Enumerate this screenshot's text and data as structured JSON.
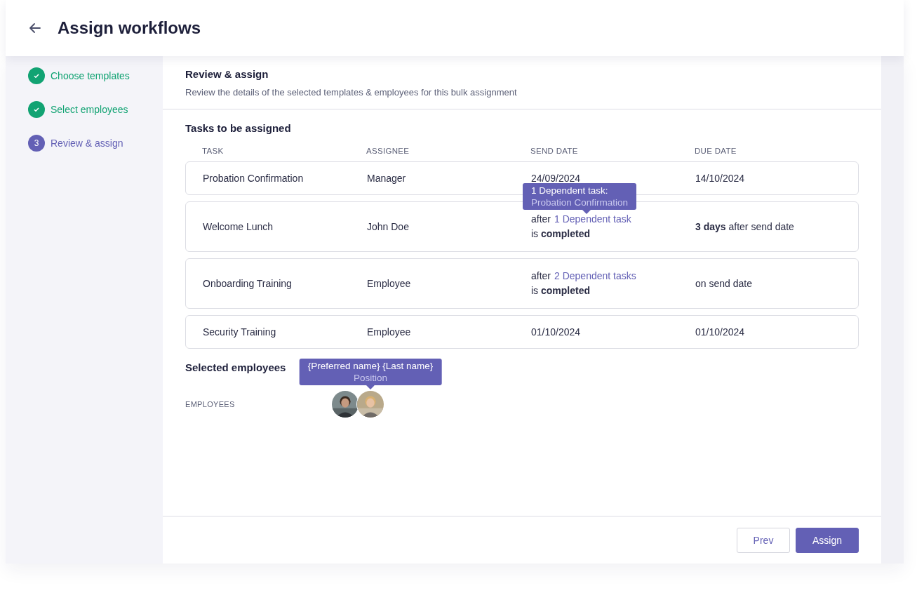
{
  "header": {
    "title": "Assign workflows"
  },
  "steps": [
    {
      "label": "Choose templates",
      "done": true
    },
    {
      "label": "Select employees",
      "done": true
    },
    {
      "label": "Review & assign",
      "done": false,
      "number": "3"
    }
  ],
  "section": {
    "title": "Review & assign",
    "description": "Review the details of the selected templates & employees for this bulk assignment"
  },
  "tasks": {
    "title": "Tasks to be assigned",
    "columns": [
      "TASK",
      "ASSIGNEE",
      "SEND DATE",
      "DUE DATE"
    ],
    "rows": [
      {
        "task": "Probation Confirmation",
        "assignee": "Manager",
        "send": {
          "kind": "date",
          "text": "24/09/2024"
        },
        "due": "14/10/2024"
      },
      {
        "task": "Welcome Lunch",
        "assignee": "John Doe",
        "send": {
          "kind": "dependency",
          "prefix": "after",
          "link": "1 Dependent task",
          "suffix": "is **completed**",
          "tooltip": {
            "title": "1 Dependent task:",
            "subtitle": "Probation Confirmation"
          }
        },
        "due": "**3 days** after send date"
      },
      {
        "task": "Onboarding Training",
        "assignee": "Employee",
        "send": {
          "kind": "dependency",
          "prefix": "after",
          "link": "2 Dependent tasks",
          "suffix": "is **completed**"
        },
        "due": "on send date"
      },
      {
        "task": "Security Training",
        "assignee": "Employee",
        "send": {
          "kind": "date",
          "text": "01/10/2024"
        },
        "due": "01/10/2024"
      }
    ]
  },
  "employees": {
    "title": "Selected employees",
    "label": "EMPLOYEES",
    "avatars": [
      {
        "kind": "picture"
      },
      {
        "kind": "picture",
        "tooltip": {
          "title": "{Preferred name} {Last name}",
          "subtitle": "Position"
        }
      }
    ]
  },
  "footer": {
    "buttons": [
      {
        "label": "Prev",
        "kind": "secondary"
      },
      {
        "label": "Assign",
        "kind": "primary"
      }
    ]
  }
}
